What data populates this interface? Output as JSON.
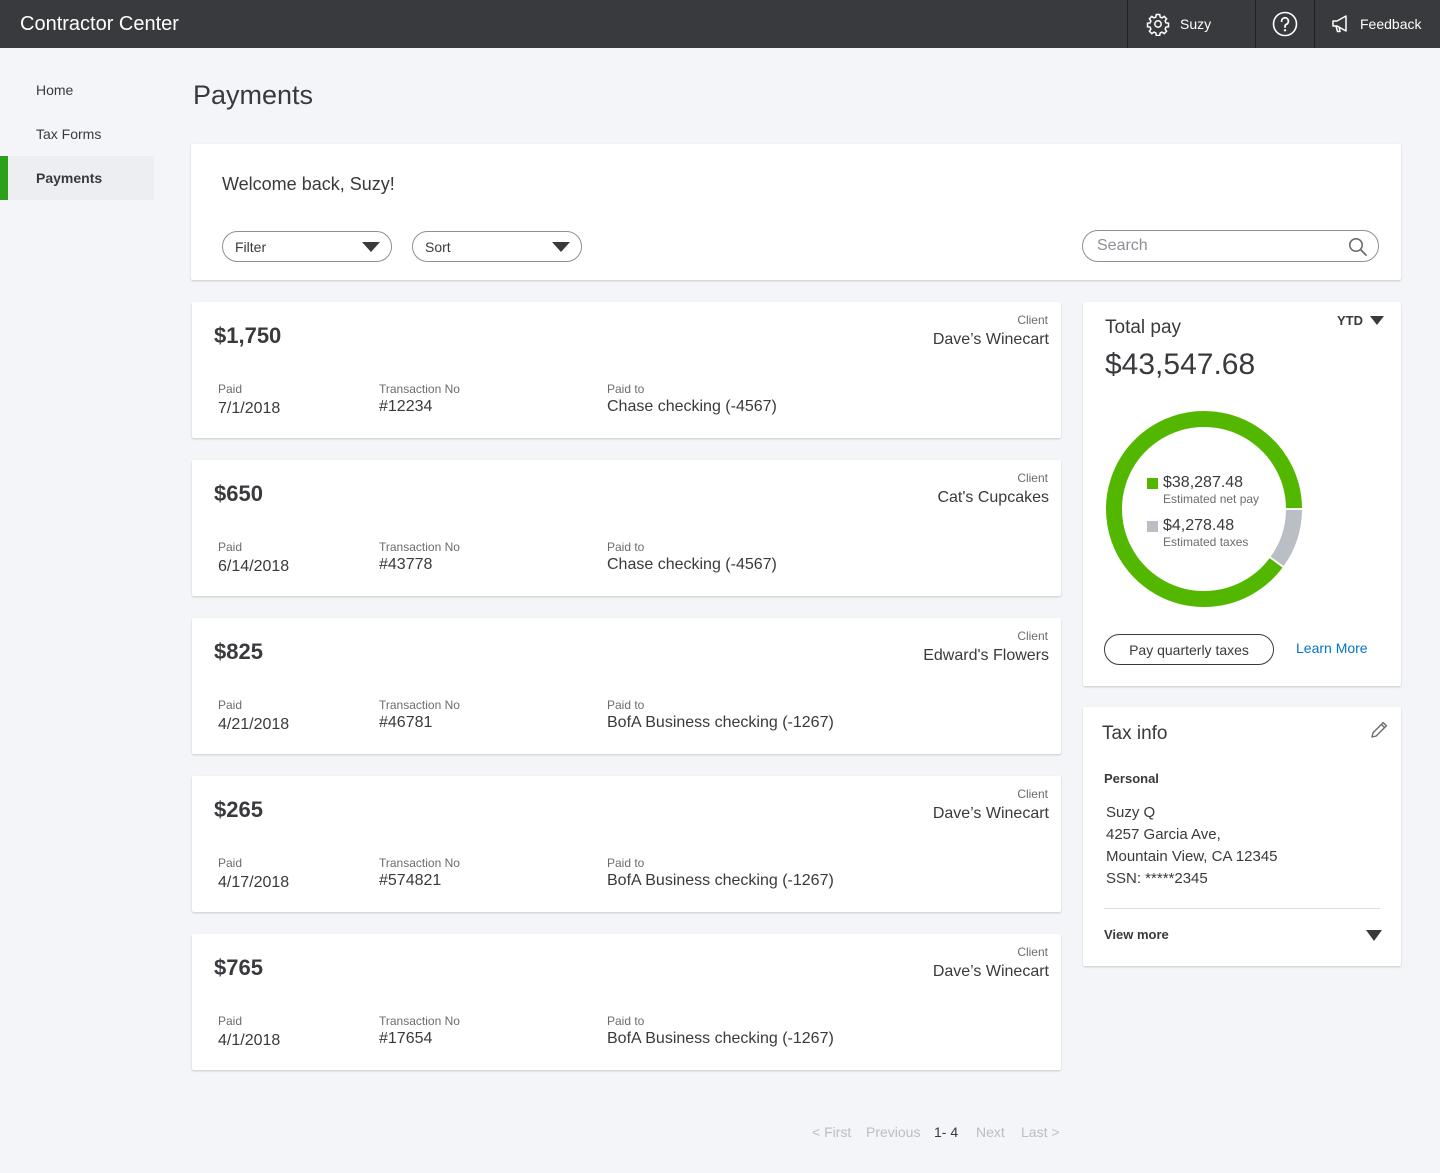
{
  "app": {
    "title": "Contractor Center"
  },
  "topbar": {
    "user_label": "Suzy",
    "feedback_label": "Feedback"
  },
  "sidebar": {
    "items": [
      {
        "label": "Home"
      },
      {
        "label": "Tax Forms"
      },
      {
        "label": "Payments",
        "active": true
      }
    ]
  },
  "page": {
    "title": "Payments"
  },
  "welcome": {
    "text": "Welcome back, Suzy!",
    "filter_label": "Filter",
    "sort_label": "Sort",
    "search_placeholder": "Search"
  },
  "payments": {
    "labels": {
      "client": "Client",
      "paid": "Paid",
      "transaction": "Transaction No",
      "paid_to": "Paid to"
    },
    "items": [
      {
        "amount": "$1,750",
        "client": "Dave’s Winecart",
        "date": "7/1/2018",
        "transaction": "#12234",
        "paid_to": "Chase checking (-4567)"
      },
      {
        "amount": "$650",
        "client": "Cat's Cupcakes",
        "date": "6/14/2018",
        "transaction": "#43778",
        "paid_to": "Chase checking (-4567)"
      },
      {
        "amount": "$825",
        "client": "Edward's Flowers",
        "date": "4/21/2018",
        "transaction": "#46781",
        "paid_to": "BofA Business checking (-1267)"
      },
      {
        "amount": "$265",
        "client": "Dave’s Winecart",
        "date": "4/17/2018",
        "transaction": "#574821",
        "paid_to": "BofA Business checking (-1267)"
      },
      {
        "amount": "$765",
        "client": "Dave’s Winecart",
        "date": "4/1/2018",
        "transaction": "#17654",
        "paid_to": "BofA Business checking (-1267)"
      }
    ]
  },
  "total_pay": {
    "title": "Total pay",
    "period": "YTD",
    "amount": "$43,547.68",
    "net": {
      "value": "$38,287.48",
      "label": "Estimated net pay",
      "amount": 38287.48,
      "color": "#53b700"
    },
    "taxes": {
      "value": "$4,278.48",
      "label": "Estimated taxes",
      "amount": 4278.48,
      "color": "#babec5"
    },
    "pay_button": "Pay quarterly taxes",
    "learn_more": "Learn More"
  },
  "tax_info": {
    "title": "Tax info",
    "section": "Personal",
    "name": "Suzy Q",
    "address1": "4257 Garcia Ave,",
    "address2": "Mountain View, CA 12345",
    "ssn": "SSN: *****2345",
    "view_more": "View more"
  },
  "pagination": {
    "first": "< First",
    "previous": "Previous",
    "range": "1- 4",
    "next": "Next",
    "last": "Last >"
  },
  "colors": {
    "topbar": "#393a3d",
    "accent_green": "#2ca01c",
    "chart_green": "#53b700",
    "chart_gray": "#babec5",
    "link_blue": "#0077c5"
  }
}
